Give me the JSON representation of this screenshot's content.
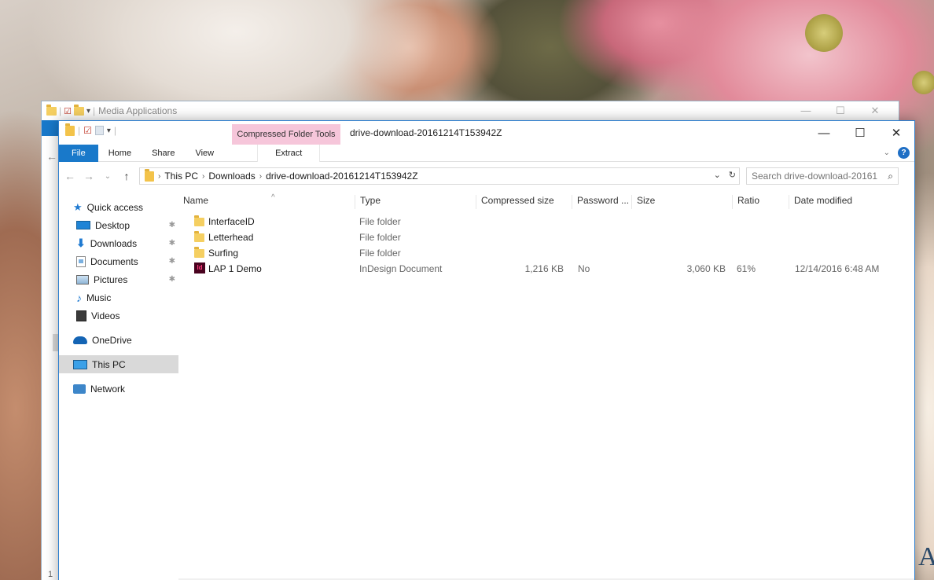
{
  "background_window": {
    "title": "Media Applications",
    "minimize": "—",
    "maximize": "☐",
    "close": "✕",
    "item_count": "1"
  },
  "window": {
    "title": "drive-download-20161214T153942Z",
    "context_tab": "Compressed Folder Tools",
    "minimize": "—",
    "maximize": "☐",
    "close": "✕"
  },
  "ribbon": {
    "tabs": [
      "File",
      "Home",
      "Share",
      "View",
      "Extract"
    ],
    "collapse": "⌄",
    "help": "?"
  },
  "address_bar": {
    "back": "←",
    "forward": "→",
    "recent": "⌄",
    "up": "↑",
    "path": [
      "This PC",
      "Downloads",
      "drive-download-20161214T153942Z"
    ],
    "dropdown": "⌄",
    "refresh": "↻"
  },
  "search": {
    "placeholder": "Search drive-download-20161...",
    "icon": "⌕"
  },
  "nav_pane": {
    "quick_access": "Quick access",
    "items": [
      {
        "label": "Desktop",
        "pinned": true
      },
      {
        "label": "Downloads",
        "pinned": true
      },
      {
        "label": "Documents",
        "pinned": true
      },
      {
        "label": "Pictures",
        "pinned": true
      },
      {
        "label": "Music",
        "pinned": false
      },
      {
        "label": "Videos",
        "pinned": false
      }
    ],
    "onedrive": "OneDrive",
    "this_pc": "This PC",
    "network": "Network",
    "pin_glyph": "✱"
  },
  "columns": {
    "name": "Name",
    "type": "Type",
    "compressed_size": "Compressed size",
    "password": "Password ...",
    "size": "Size",
    "ratio": "Ratio",
    "date_modified": "Date modified",
    "sort_indicator": "^"
  },
  "files": [
    {
      "name": "InterfaceID",
      "type": "File folder",
      "compressed_size": "",
      "password": "",
      "size": "",
      "ratio": "",
      "date": "",
      "icon": "folder-icon"
    },
    {
      "name": "Letterhead",
      "type": "File folder",
      "compressed_size": "",
      "password": "",
      "size": "",
      "ratio": "",
      "date": "",
      "icon": "folder-icon"
    },
    {
      "name": "Surfing",
      "type": "File folder",
      "compressed_size": "",
      "password": "",
      "size": "",
      "ratio": "",
      "date": "",
      "icon": "folder-icon"
    },
    {
      "name": "LAP 1 Demo",
      "type": "InDesign Document",
      "compressed_size": "1,216 KB",
      "password": "No",
      "size": "3,060 KB",
      "ratio": "61%",
      "date": "12/14/2016 6:48 AM",
      "icon": "indesign-icon"
    }
  ],
  "scrollbar": {
    "left": "‹",
    "right": "›"
  },
  "colors": {
    "accent": "#1979ca",
    "context_tab": "#f6c6da",
    "selection": "#d9d9d9",
    "folder": "#f5cf61"
  }
}
